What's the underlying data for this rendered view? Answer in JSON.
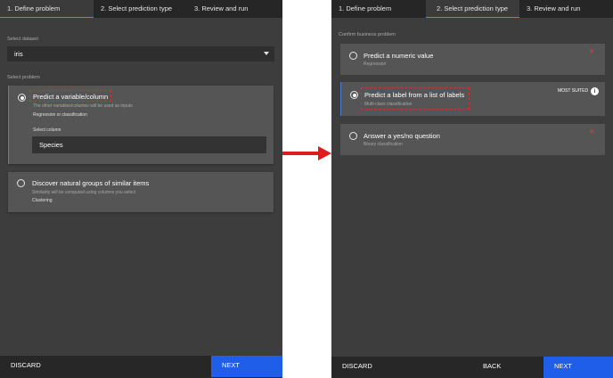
{
  "left": {
    "tabs": [
      "1. Define problem",
      "2. Select prediction type",
      "3. Review and run"
    ],
    "dataset_label": "Select dataset",
    "dataset_value": "iris",
    "problem_label": "Select problem",
    "option1": {
      "title": "Predict a variable/column",
      "desc": "The other variables/columns will be used as inputs",
      "sub": "Regression or classification",
      "column_label": "Select column",
      "column_value": "Species"
    },
    "option2": {
      "title": "Discover natural groups of similar items",
      "desc": "Similarity will be computed using columns you select",
      "sub": "Clustering"
    },
    "footer": {
      "discard": "DISCARD",
      "next": "NEXT"
    }
  },
  "right": {
    "tabs": [
      "1. Define problem",
      "2. Select prediction type",
      "3. Review and run"
    ],
    "confirm_label": "Confirm business problem",
    "option1": {
      "title": "Predict a numeric value",
      "sub": "Regression"
    },
    "option2": {
      "title": "Predict a label from a list of labels",
      "sub": "Multi-class classification",
      "badge": "MOST SUITED",
      "info": "i"
    },
    "option3": {
      "title": "Answer a yes/no question",
      "sub": "Binary classification"
    },
    "close": "×",
    "footer": {
      "discard": "DISCARD",
      "back": "BACK",
      "next": "NEXT"
    }
  },
  "colors": {
    "panel_bg": "#3d3d3d",
    "card_bg": "#555555",
    "accent_blue": "#1e5ee8",
    "tab_underline": "#4a90d9",
    "annotation_red": "#e23a32"
  },
  "arrow_icon": "red-right-arrow"
}
